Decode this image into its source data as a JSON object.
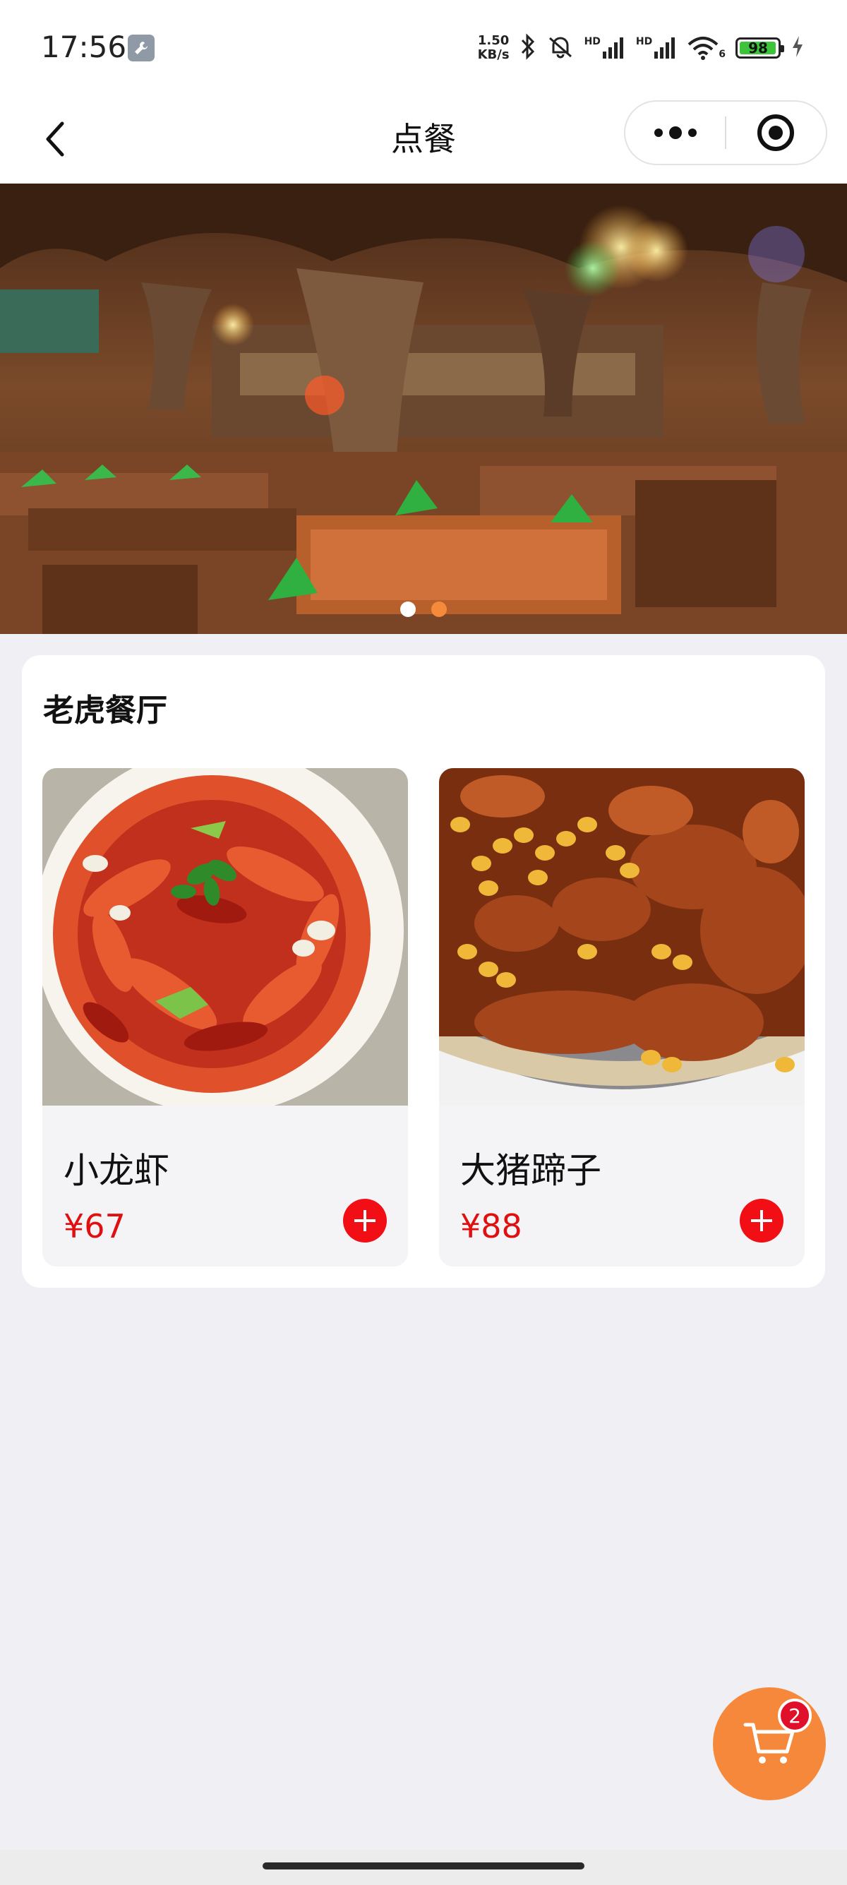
{
  "status_bar": {
    "time": "17:56",
    "net_speed_value": "1.50",
    "net_speed_unit": "KB/s",
    "signal_label_1": "HD",
    "signal_label_2": "HD",
    "wifi_label": "6",
    "battery_percent": "98"
  },
  "nav": {
    "title": "点餐",
    "back_icon": "chevron-left-icon",
    "more_icon": "more-dots-icon",
    "close_icon": "target-circle-icon"
  },
  "banner": {
    "slide_count": 2,
    "active_slide": 2
  },
  "shop": {
    "name": "老虎餐厅"
  },
  "dishes": [
    {
      "name": "小龙虾",
      "price": "¥67",
      "image": "crayfish-dish-image"
    },
    {
      "name": "大猪蹄子",
      "price": "¥88",
      "image": "braised-pork-trotter-image"
    }
  ],
  "cart": {
    "icon": "shopping-cart-icon",
    "count": "2"
  },
  "colors": {
    "accent": "#f5883a",
    "price": "#e01010",
    "add_button": "#f10e14",
    "badge": "#e0102a"
  }
}
